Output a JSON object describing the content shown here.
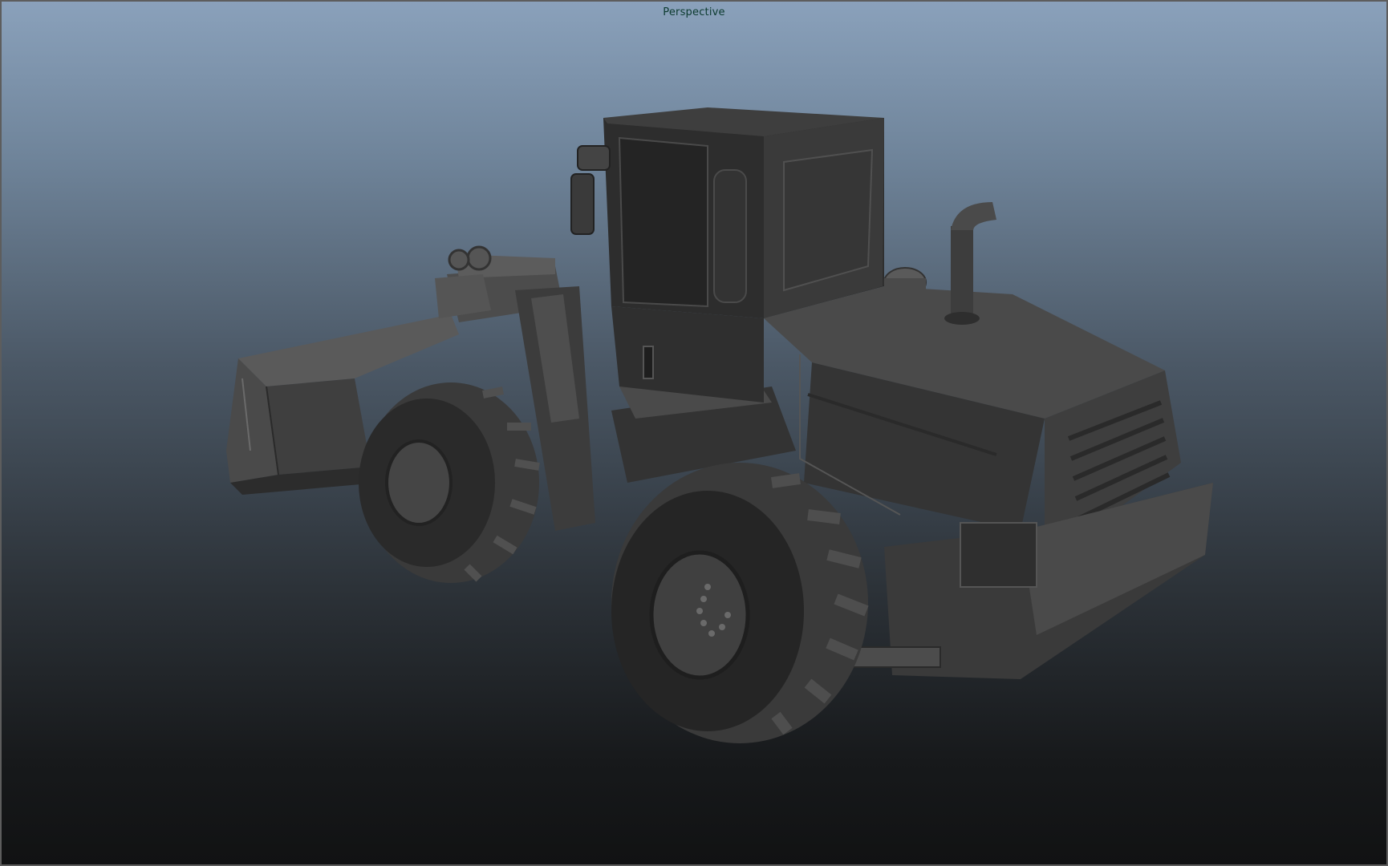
{
  "viewport": {
    "camera_label": "Perspective"
  },
  "scene": {
    "object": "wheel-loader-model",
    "shading": "flat-grey",
    "colors": {
      "background_top": "#8aa1bb",
      "background_bottom": "#111213",
      "label": "#0b3a2e",
      "model_dark": "#2a2a2a",
      "model_mid": "#4a4a4a",
      "model_light": "#5c5c5c"
    }
  }
}
